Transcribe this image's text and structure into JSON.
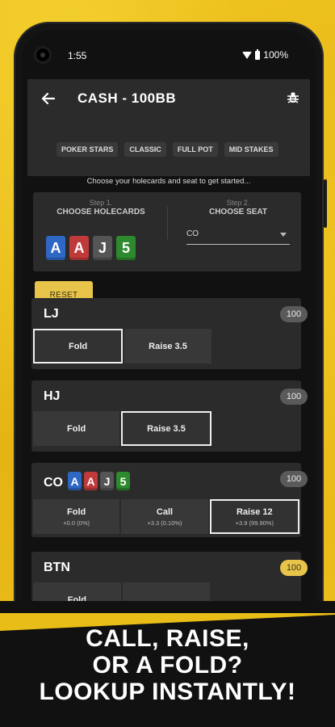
{
  "status_bar": {
    "time": "1:55",
    "battery": "100%"
  },
  "app_bar": {
    "title": "CASH - 100BB",
    "chips": [
      "POKER STARS",
      "CLASSIC",
      "FULL POT",
      "MID STAKES"
    ]
  },
  "prompt": "Choose your holecards and seat to get started...",
  "step1": {
    "step": "Step 1.",
    "label": "CHOOSE HOLECARDS"
  },
  "step2": {
    "step": "Step 2.",
    "label": "CHOOSE SEAT",
    "value": "CO"
  },
  "hole_cards": [
    {
      "rank": "A",
      "color": "#2f67c4"
    },
    {
      "rank": "A",
      "color": "#c03a3a"
    },
    {
      "rank": "J",
      "color": "#555555"
    },
    {
      "rank": "5",
      "color": "#2e8a2e"
    }
  ],
  "reset_label": "RESET",
  "positions": {
    "lj": {
      "name": "LJ",
      "stack": "100",
      "fold": "Fold",
      "raise": "Raise 3.5"
    },
    "hj": {
      "name": "HJ",
      "stack": "100",
      "fold": "Fold",
      "raise": "Raise 3.5"
    },
    "co": {
      "name": "CO",
      "stack": "100",
      "fold": "Fold",
      "fold_sub": "+0.0  (0%)",
      "call": "Call",
      "call_sub": "+3.3  (0.10%)",
      "raise": "Raise 12",
      "raise_sub": "+3.9  (99.90%)"
    },
    "btn": {
      "name": "BTN",
      "stack": "100",
      "fold": "Fold"
    }
  },
  "banner": {
    "line1": "CALL, RAISE,",
    "line2": "OR A FOLD?",
    "line3": "LOOKUP INSTANTLY!"
  },
  "colors": {
    "accent": "#e8c54a",
    "background": "#e8bd18",
    "panel": "#2b2b2b"
  }
}
